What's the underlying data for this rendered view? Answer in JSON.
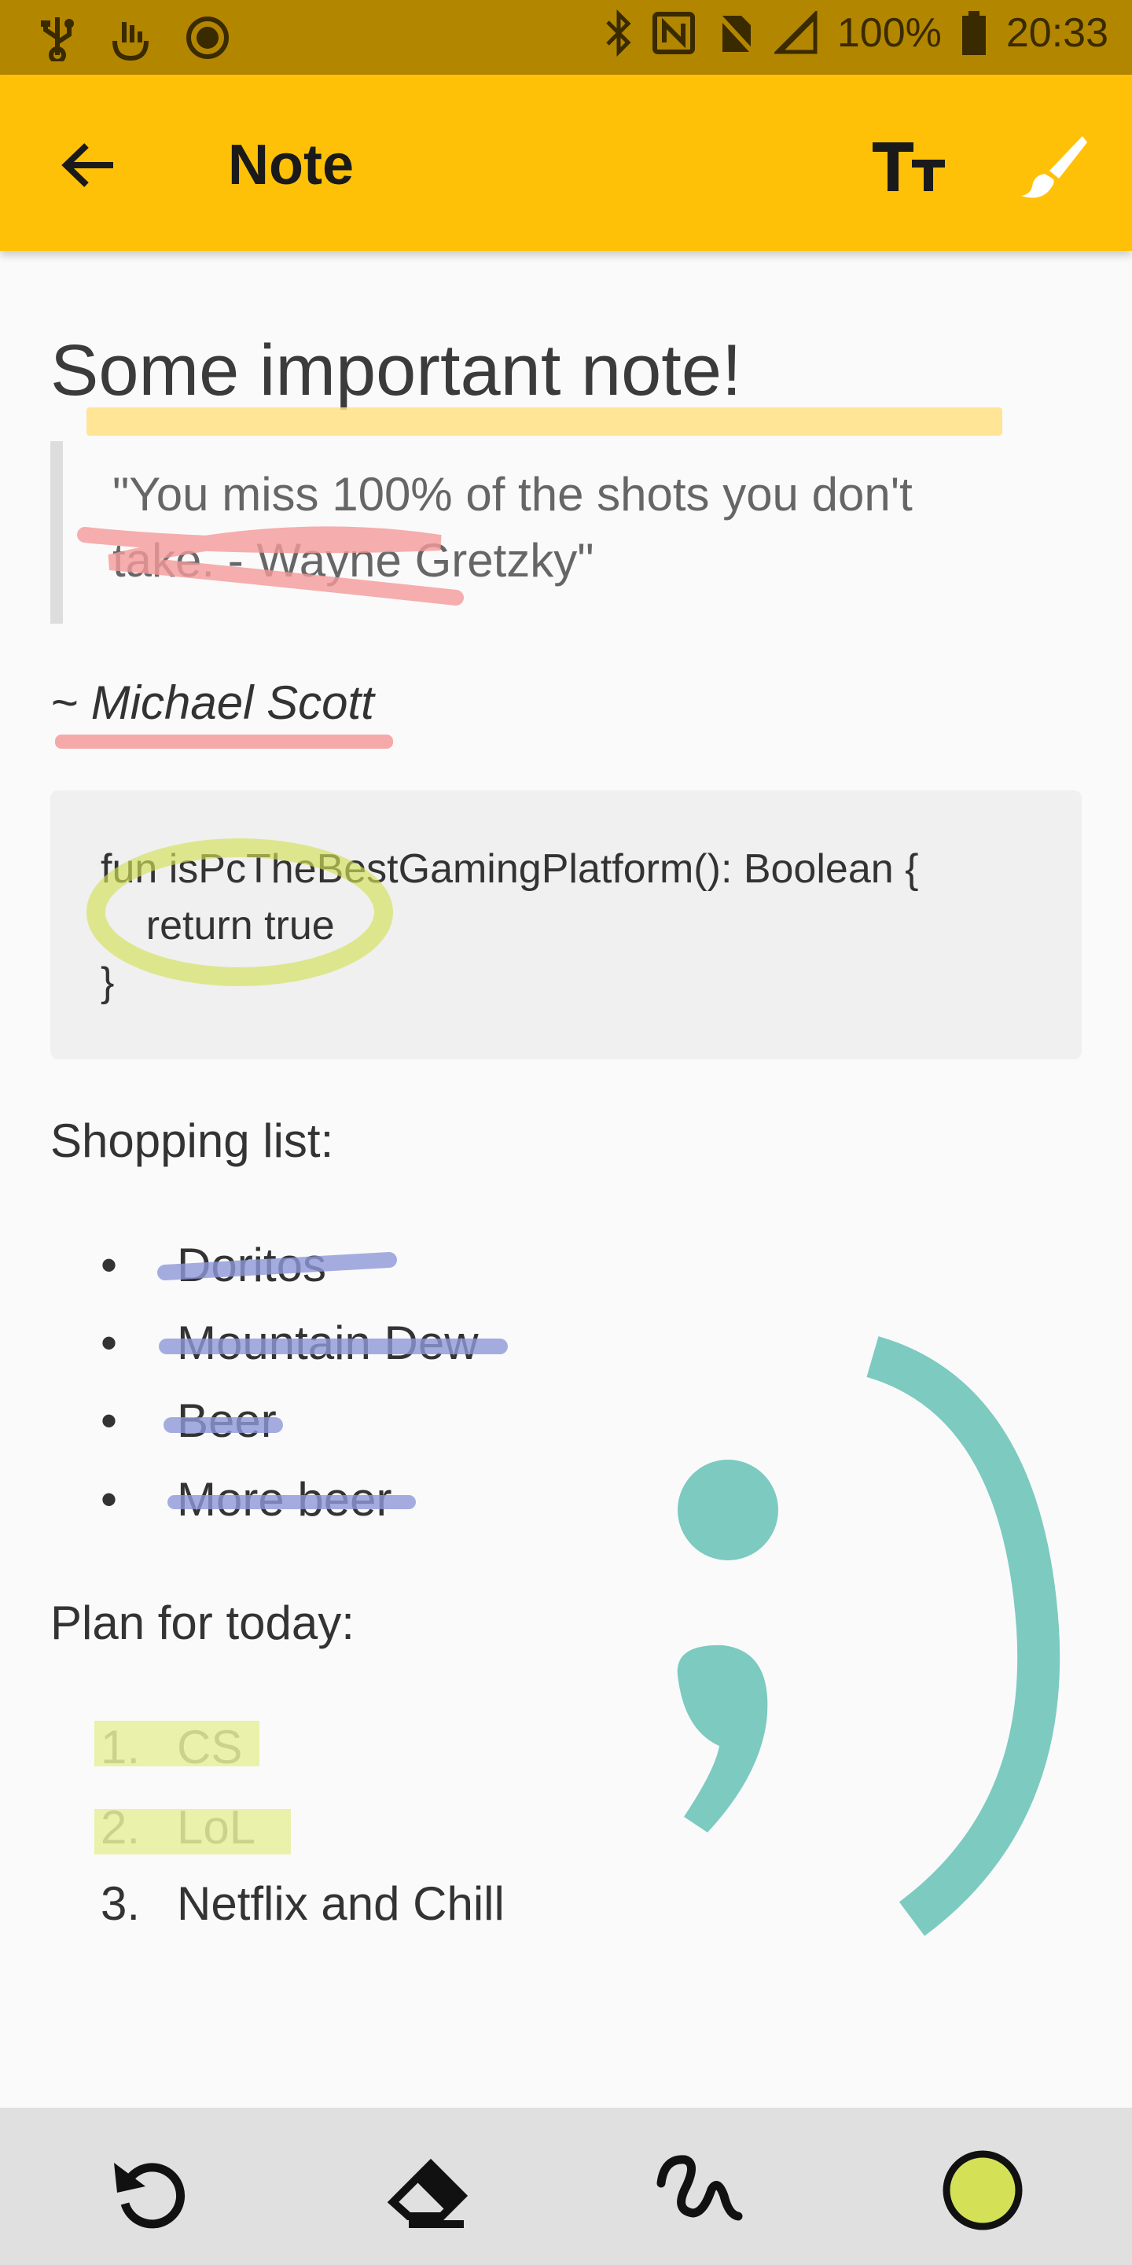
{
  "status_bar": {
    "battery": "100%",
    "time": "20:33"
  },
  "app_bar": {
    "title": "Note",
    "icons": [
      "back-arrow-icon",
      "text-size-icon",
      "brush-icon"
    ]
  },
  "note": {
    "heading": "Some important note!",
    "quote_line1": "\"You miss 100% of the shots you don't",
    "quote_line2": "take. - Wayne Gretzky\"",
    "author": "~ Michael Scott",
    "code_line1": "fun isPcTheBestGamingPlatform(): Boolean {",
    "code_line2": "    return true",
    "code_line3": "}",
    "shopping_title": "Shopping list:",
    "shopping_items": [
      "Doritos",
      "Mountain Dew",
      "Beer",
      "More beer"
    ],
    "plan_title": "Plan for today:",
    "plan_items": [
      {
        "num": "1.",
        "text": "CS"
      },
      {
        "num": "2.",
        "text": "LoL"
      },
      {
        "num": "3.",
        "text": "Netflix and Chill"
      }
    ]
  },
  "colors": {
    "app_bar": "#FFC107",
    "status_bar": "#B38600",
    "highlight_yellow": "#FFE082",
    "highlight_red": "#F59A9A",
    "highlight_lime": "#E6EE9C",
    "strike_blue": "#8E99D8",
    "smiley_teal": "#7CCAC0",
    "selected_color": "#D4E157"
  },
  "bottom_toolbar": {
    "icons": [
      "undo-icon",
      "eraser-icon",
      "pen-icon",
      "color-picker-icon"
    ]
  }
}
